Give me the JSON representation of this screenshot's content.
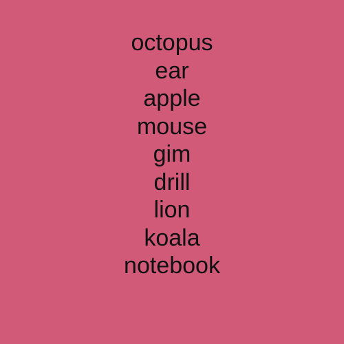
{
  "background_color": "#d15a79",
  "text_color": "#111111",
  "words": [
    "octopus",
    "ear",
    "apple",
    "mouse",
    "gim",
    "drill",
    "lion",
    "koala",
    "notebook"
  ]
}
